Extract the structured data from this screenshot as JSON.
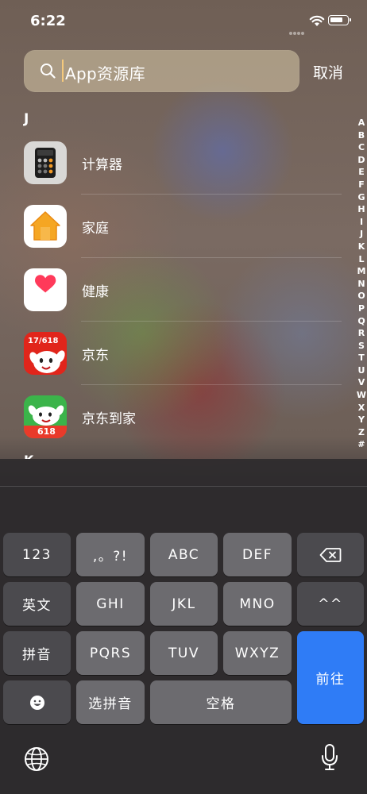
{
  "status_bar": {
    "time": "6:22"
  },
  "search": {
    "placeholder": "App资源库",
    "cancel_label": "取消"
  },
  "sections": {
    "j_header": "J",
    "k_header": "K"
  },
  "apps": [
    {
      "name": "计算器",
      "icon": "calculator-icon"
    },
    {
      "name": "家庭",
      "icon": "home-app-icon"
    },
    {
      "name": "健康",
      "icon": "health-app-icon"
    },
    {
      "name": "京东",
      "icon": "jd-app-icon"
    },
    {
      "name": "京东到家",
      "icon": "jd-daojia-app-icon"
    }
  ],
  "app_badges": {
    "jd": "17/618",
    "jd_daojia": "618"
  },
  "index_letters": [
    "A",
    "B",
    "C",
    "D",
    "E",
    "F",
    "G",
    "H",
    "I",
    "J",
    "K",
    "L",
    "M",
    "N",
    "O",
    "P",
    "Q",
    "R",
    "S",
    "T",
    "U",
    "V",
    "W",
    "X",
    "Y",
    "Z",
    "#"
  ],
  "keyboard": {
    "row1": {
      "k123": "123",
      "punct": ",。?!",
      "abc": "ABC",
      "def": "DEF",
      "delete": "delete-icon"
    },
    "row2": {
      "english": "英文",
      "ghi": "GHI",
      "jkl": "JKL",
      "mno": "MNO",
      "caret": "^^"
    },
    "row3": {
      "pinyin": "拼音",
      "pqrs": "PQRS",
      "tuv": "TUV",
      "wxyz": "WXYZ",
      "go": "前往"
    },
    "row4": {
      "emoji": "emoji-icon",
      "select_pinyin": "选拼音",
      "space": "空格"
    },
    "bottom": {
      "globe": "globe-icon",
      "mic": "microphone-icon"
    }
  },
  "colors": {
    "go_key": "#2f7cf6",
    "search_field": "#cdbea0",
    "cursor": "#f5c97c"
  }
}
